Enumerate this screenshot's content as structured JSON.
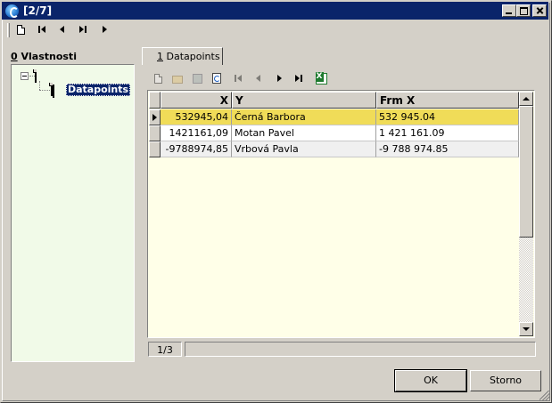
{
  "window": {
    "title": "[2/7]"
  },
  "left_panel": {
    "label_accel": "0",
    "label_rest": " Vlastnosti",
    "tree": {
      "selected_label": "Datapoints"
    }
  },
  "tab": {
    "label_accel": "1",
    "label_rest": " Datapoints"
  },
  "grid": {
    "columns": [
      "X",
      "Y",
      "Frm X"
    ],
    "rows": [
      {
        "x": "532945,04",
        "y": "Černá Barbora",
        "frm_x": "532 945.04"
      },
      {
        "x": "1421161,09",
        "y": "Motan Pavel",
        "frm_x": "1 421 161.09"
      },
      {
        "x": "-9788974,85",
        "y": "Vrbová Pavla",
        "frm_x": "-9 788 974.85"
      }
    ],
    "selected_row_color": "#f0dc58",
    "background_color": "#ffffe8"
  },
  "status": {
    "record_position": "1/3"
  },
  "buttons": {
    "ok": "OK",
    "cancel": "Storno"
  },
  "colors": {
    "titlebar": "#0a246a",
    "tree_background": "#f1fae8",
    "face": "#d4d0c8"
  }
}
